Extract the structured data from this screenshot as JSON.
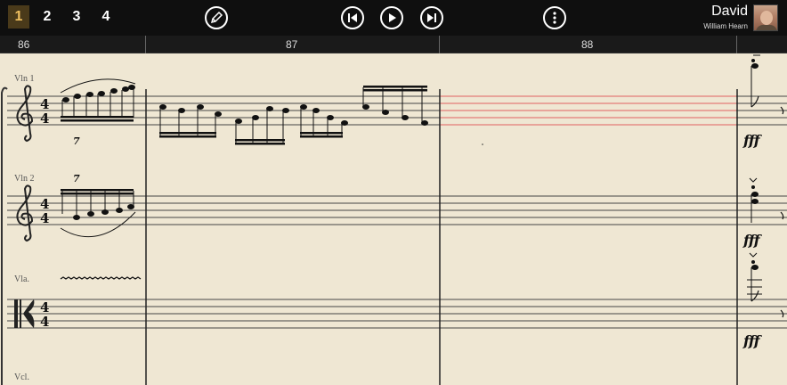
{
  "topbar": {
    "pages": [
      {
        "label": "1",
        "active": true
      },
      {
        "label": "2",
        "active": false
      },
      {
        "label": "3",
        "active": false
      },
      {
        "label": "4",
        "active": false
      }
    ],
    "user_name": "David",
    "user_subtitle": "William Hearn",
    "icons": {
      "edit": "pencil-icon",
      "previous": "skip-previous-icon",
      "play": "play-icon",
      "next": "skip-next-icon",
      "more": "more-vertical-icon"
    }
  },
  "ruler": {
    "bar_numbers": [
      "86",
      "87",
      "88"
    ]
  },
  "score": {
    "instruments": [
      "Vln 1",
      "Vln 2",
      "Vla.",
      "Vcl."
    ],
    "tuplet_label": "7",
    "time_signature": [
      "4",
      "4"
    ],
    "dynamic": "fff",
    "highlight_color": "#e06060"
  }
}
